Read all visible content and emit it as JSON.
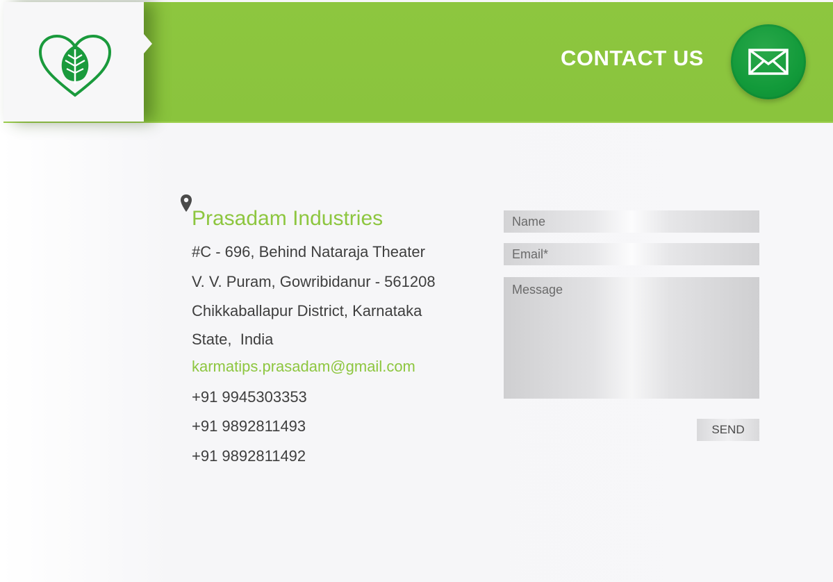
{
  "header": {
    "title": "CONTACT US",
    "logo_icon": "heart-leaf-icon",
    "mail_icon": "envelope-icon",
    "brand_color": "#8dc63f",
    "badge_color": "#129a3a"
  },
  "contact": {
    "location_icon": "map-pin-icon",
    "company": "Prasadam Industries",
    "address_lines": [
      "#C - 696, Behind Nataraja Theater",
      "V. V. Puram, Gowribidanur - 561208",
      "Chikkaballapur District, Karnataka",
      "State,  India"
    ],
    "email": "karmatips.prasadam@gmail.com",
    "phones": [
      "+91 9945303353",
      "+91 9892811493",
      "+91 9892811492"
    ]
  },
  "form": {
    "name_placeholder": "Name",
    "email_placeholder": "Email*",
    "message_placeholder": "Message",
    "send_label": "SEND"
  }
}
